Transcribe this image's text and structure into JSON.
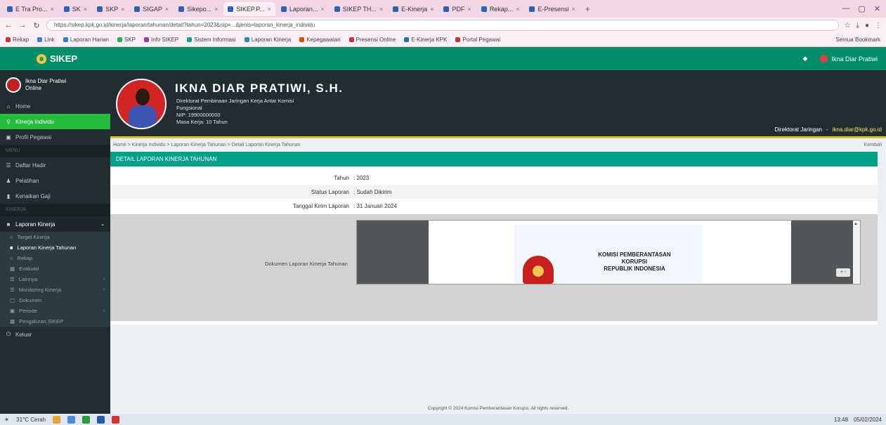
{
  "browser": {
    "tabs": [
      {
        "label": "E Tra Pro...",
        "active": false
      },
      {
        "label": "SK",
        "active": false
      },
      {
        "label": "SKP",
        "active": false
      },
      {
        "label": "SIGAP",
        "active": false
      },
      {
        "label": "Sikepo...",
        "active": false
      },
      {
        "label": "SIKEP.P...",
        "active": true
      },
      {
        "label": "Laporan...",
        "active": false
      },
      {
        "label": "SIKEP TH...",
        "active": false
      },
      {
        "label": "E-Kinerja",
        "active": false
      },
      {
        "label": "PDF",
        "active": false
      },
      {
        "label": "Rekap...",
        "active": false
      },
      {
        "label": "E-Presensi",
        "active": false
      }
    ],
    "new_tab": "+",
    "url": "https://sikep.kpk.go.id/kinerja/laporan/tahunan/detail?tahun=2023&nip=...&jenis=laporan_kinerja_individu",
    "bookmarks": [
      {
        "label": "Rekap",
        "color": "#c0392b"
      },
      {
        "label": "Link",
        "color": "#3b7dd8"
      },
      {
        "label": "Laporan Harian",
        "color": "#2e86c1"
      },
      {
        "label": "SKP",
        "color": "#27ae60"
      },
      {
        "label": "Info SIKEP",
        "color": "#8e44ad"
      },
      {
        "label": "Sistem Informasi",
        "color": "#16a085"
      },
      {
        "label": "Laporan Kinerja",
        "color": "#2e86c1"
      },
      {
        "label": "Kepegawaian",
        "color": "#d35400"
      },
      {
        "label": "Presensi Online",
        "color": "#c0392b"
      },
      {
        "label": "E-Kinerja KPK",
        "color": "#2471a3"
      },
      {
        "label": "Portal Pegawai",
        "color": "#c0392b"
      }
    ],
    "bookmarks_right": "Semua Bookmark"
  },
  "app": {
    "name": "SIKEP",
    "header_user": "Ikna Diar Pratiwi"
  },
  "sidebar": {
    "user_name": "Ikna Diar Pratiwi",
    "user_status": "Online",
    "items": [
      {
        "label": "Home",
        "icon": "home-icon",
        "glyph": "⌂"
      },
      {
        "label": "Kinerja Individu",
        "icon": "search-icon",
        "glyph": "⚲",
        "active": true
      },
      {
        "label": "Profil Pegawai",
        "icon": "user-icon",
        "glyph": "▣"
      }
    ],
    "header_menu": "MENU",
    "items2": [
      {
        "label": "Daftar Hadir",
        "icon": "list-icon",
        "glyph": "☰"
      },
      {
        "label": "Pelatihan",
        "icon": "user-group-icon",
        "glyph": "♟"
      },
      {
        "label": "Kenaikan Gaji",
        "icon": "money-icon",
        "glyph": "▮"
      }
    ],
    "header_kinerja": "KINERJA",
    "group_label": "Laporan Kinerja",
    "sub_items": [
      {
        "label": "Target Kinerja",
        "glyph": "○"
      },
      {
        "label": "Laporan Kinerja Tahunan",
        "glyph": "■",
        "current": true
      },
      {
        "label": "Rekap",
        "glyph": "○"
      },
      {
        "label": "Evaluasi",
        "glyph": "▦"
      },
      {
        "label": "Lainnya",
        "glyph": "☰",
        "caret": "‹"
      },
      {
        "label": "Monitoring Kinerja",
        "glyph": "☰",
        "caret": "‹"
      },
      {
        "label": "Dokumen",
        "glyph": "▢"
      },
      {
        "label": "Periode",
        "glyph": "▣",
        "caret": "‹"
      },
      {
        "label": "Pengaturan SIKEP",
        "glyph": "▦"
      }
    ],
    "logout": "Keluar"
  },
  "profile": {
    "name": "IKNA DIAR PRATIWI, S.H.",
    "lines": [
      "Direktorat Pembinaan Jaringan Kerja Antar Komisi",
      "Fungsional",
      "NIP: 19900000000",
      "Masa Kerja: 10 Tahun"
    ],
    "right_label": "Direktorat Jaringan",
    "right_sep": "-",
    "right_email": "ikna.diar@kpk.go.id"
  },
  "breadcrumb": {
    "text": "Home > Kinerja Individu > Laporan Kinerja Tahunan > Detail Laporan Kinerja Tahunan",
    "right": "Kembali"
  },
  "panel": {
    "title": "DETAIL LAPORAN KINERJA TAHUNAN"
  },
  "form": {
    "rows": [
      {
        "label": "Tahun",
        "value": ": 2023"
      },
      {
        "label": "Status Laporan",
        "value": ": Sudah Dikirim"
      },
      {
        "label": "Tanggal Kirim Laporan",
        "value": ": 31 Januari 2024"
      }
    ],
    "attachment_label": "Dokumen Laporan Kinerja Tahunan"
  },
  "pdf": {
    "heading_lines": [
      "KOMISI PEMBERANTASAN",
      "KORUPSI",
      "REPUBLIK INDONESIA"
    ],
    "zoom_label": "+ -"
  },
  "footer": {
    "text": "Copyright © 2024 Komisi Pemberantasan Korupsi. All rights reserved."
  },
  "taskbar": {
    "weather": "31°C Cerah",
    "time": "13:48",
    "date": "05/02/2024"
  }
}
